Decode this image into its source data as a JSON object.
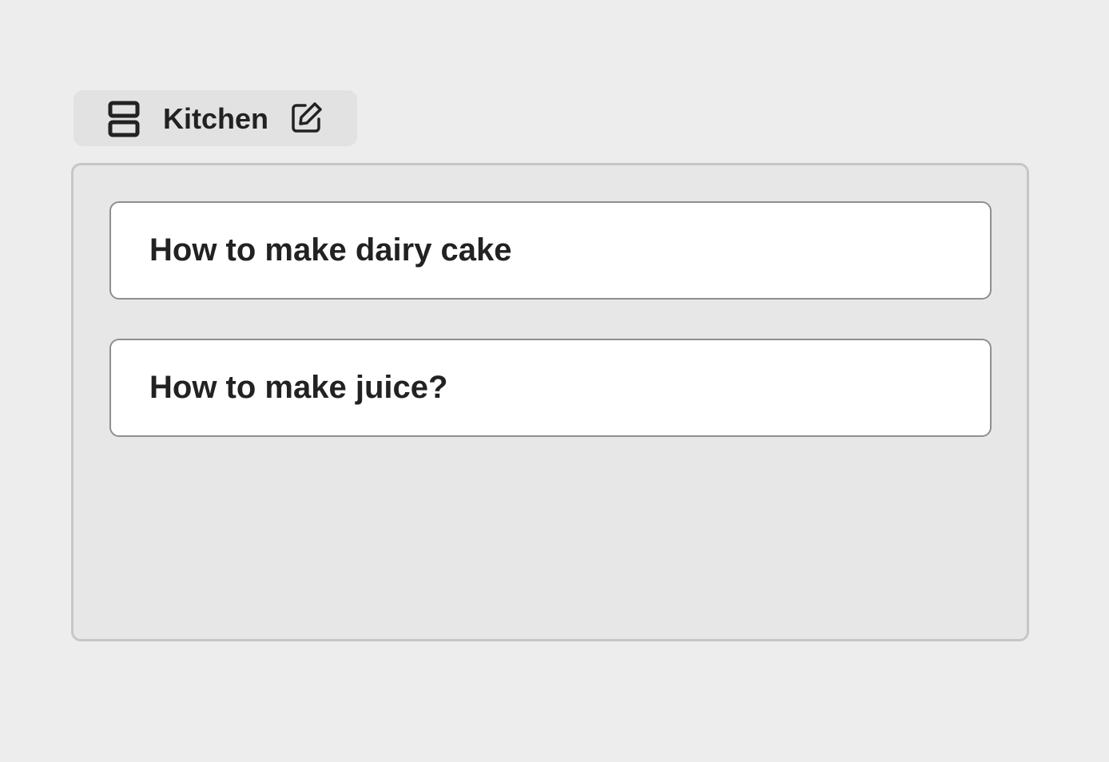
{
  "group": {
    "title": "Kitchen",
    "icon": "stack-icon",
    "edit_icon": "edit-icon"
  },
  "cards": [
    {
      "label": "How to make dairy cake"
    },
    {
      "label": "How to make juice?"
    }
  ],
  "colors": {
    "page_background": "#ededed",
    "header_background": "#e2e2e2",
    "panel_background": "#e7e7e7",
    "panel_border": "#c6c6c6",
    "card_background": "#ffffff",
    "card_border": "#8f8f8f",
    "text": "#222222"
  }
}
